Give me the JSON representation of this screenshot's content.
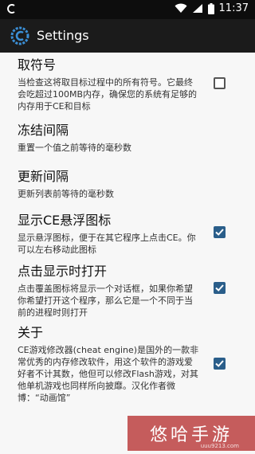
{
  "statusbar": {
    "time": "11:37"
  },
  "appbar": {
    "title": "Settings"
  },
  "prefs": [
    {
      "title": "取符号",
      "summary": "当检查这将取目标过程中的所有符号。它最终会吃超过100MB内存，确保您的系统有足够的内存用于CE和目标",
      "checked": false
    },
    {
      "title": "冻结间隔",
      "summary": "重置一个值之前等待的毫秒数"
    },
    {
      "title": "更新间隔",
      "summary": "更新列表前等待的毫秒数"
    },
    {
      "title": "显示CE悬浮图标",
      "summary": "显示悬浮图标，便于在其它程序上点击CE。你可以左右移动此图标",
      "checked": true
    },
    {
      "title": "点击显示时打开",
      "summary": "点击覆盖图标将显示一个对话框，如果你希望你希望打开这个程序，那么它是一个不同于当前的进程时则打开",
      "checked": true
    },
    {
      "title": "关于",
      "summary": "CE游戏修改器(cheat engine)是国外的一款非常优秀的内存修改软件，用这个软件的游戏爱好者不计其数，他但可以修改Flash游戏，对其他单机游戏也同样所向披靡。汉化作者微博：“动画馆”",
      "checked": true
    }
  ],
  "watermark": {
    "text": "悠哈手游",
    "url": "uuu9213.com"
  },
  "colors": {
    "accent": "#2a5e8a",
    "appbar": "#1b1b1b",
    "statusbar": "#0d0d0d"
  },
  "icons": {
    "app_logo": "cheat-engine-logo-icon",
    "wifi": "wifi-icon",
    "signal": "signal-icon",
    "battery": "battery-icon"
  }
}
